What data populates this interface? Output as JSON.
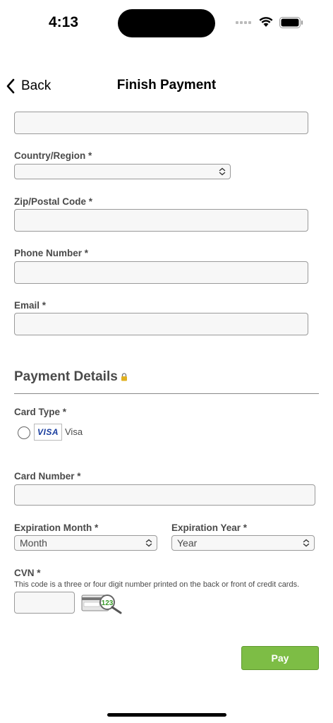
{
  "status_bar": {
    "time": "4:13"
  },
  "nav": {
    "back_label": "Back",
    "title": "Finish Payment"
  },
  "billing": {
    "country_label": "Country/Region *",
    "country_value": "",
    "zip_label": "Zip/Postal Code *",
    "phone_label": "Phone Number *",
    "email_label": "Email *"
  },
  "payment": {
    "section_title": "Payment Details",
    "card_type_label": "Card Type *",
    "card_brand_logo": "VISA",
    "card_brand_label": "Visa",
    "card_number_label": "Card Number *",
    "exp_month_label": "Expiration Month *",
    "exp_month_value": "Month",
    "exp_year_label": "Expiration Year *",
    "exp_year_value": "Year",
    "cvn_label": "CVN *",
    "cvn_help": "This code is a three or four digit number printed on the back or front of credit cards.",
    "cvn_image_text": "123",
    "pay_label": "Pay"
  },
  "colors": {
    "pay_button": "#7dbd45",
    "lock": "#e0b020",
    "visa_blue": "#1a3e9e"
  },
  "icons": [
    "chevron-left-icon",
    "lock-icon",
    "updown-chevron-icon",
    "wifi-icon",
    "battery-icon",
    "cell-signal-icon",
    "magnifier-icon"
  ]
}
